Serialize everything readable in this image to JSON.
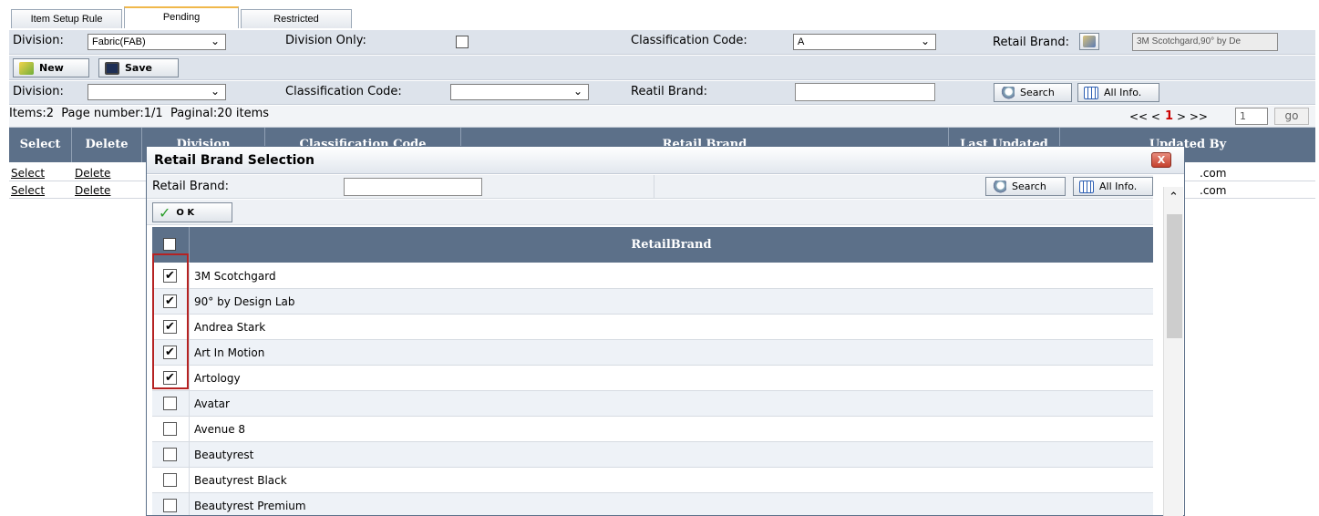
{
  "tabs": [
    "Item Setup Rule",
    "Pending",
    "Restricted"
  ],
  "filter_row1": {
    "division_label": "Division:",
    "division_value": "Fabric(FAB)",
    "division_only_label": "Division Only:",
    "classification_label": "Classification Code:",
    "classification_value": "A",
    "retail_brand_label": "Retail Brand:",
    "retail_brand_value": "3M Scotchgard,90° by De"
  },
  "toolbar": {
    "new_label": "New",
    "save_label": "Save"
  },
  "filter_row2": {
    "division_label": "Division:",
    "classification_label": "Classification Code:",
    "retail_brand_label": "Reatil Brand:",
    "search_label": "Search",
    "allinfo_label": "All Info."
  },
  "pager": {
    "summary": "Items:2  Page number:1/1  Paginal:20 items",
    "nav_left": "<< <",
    "current": "1",
    "nav_right": "> >>",
    "page_input": "1",
    "go_label": "go"
  },
  "grid": {
    "headers": [
      "Select",
      "Delete",
      "Division",
      "Classification Code",
      "Retail Brand",
      "Last Updated",
      "Updated By"
    ],
    "rows": [
      {
        "select": "Select",
        "delete": "Delete",
        "updated_by": ".com"
      },
      {
        "select": "Select",
        "delete": "Delete",
        "updated_by": ".com"
      }
    ]
  },
  "modal": {
    "title": "Retail Brand Selection",
    "close_label": "X",
    "retail_brand_label": "Retail Brand:",
    "search_label": "Search",
    "allinfo_label": "All Info.",
    "ok_label": "O K",
    "column_header": "RetailBrand",
    "brands": [
      {
        "name": "3M Scotchgard",
        "checked": true
      },
      {
        "name": "90° by Design Lab",
        "checked": true
      },
      {
        "name": "Andrea Stark",
        "checked": true
      },
      {
        "name": "Art In Motion",
        "checked": true
      },
      {
        "name": "Artology",
        "checked": true
      },
      {
        "name": "Avatar",
        "checked": false
      },
      {
        "name": "Avenue 8",
        "checked": false
      },
      {
        "name": "Beautyrest",
        "checked": false
      },
      {
        "name": "Beautyrest Black",
        "checked": false
      },
      {
        "name": "Beautyrest Premium",
        "checked": false
      }
    ]
  },
  "colors": {
    "header_bg": "#5c7089",
    "row_bg": "#dde3eb",
    "highlight": "#b52222",
    "pager_current": "#cc0000"
  }
}
